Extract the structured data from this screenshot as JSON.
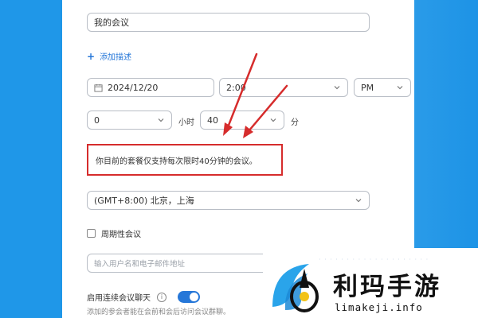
{
  "form": {
    "title_value": "我的会议",
    "add_description": "添加描述",
    "date_value": "2024/12/20",
    "time_value": "2:00",
    "ampm_value": "PM",
    "duration_hours": "0",
    "hours_unit": "小时",
    "duration_minutes": "40",
    "minutes_unit": "分",
    "limit_notice": "你目前的套餐仅支持每次限时40分钟的会议。",
    "timezone_value": "(GMT+8:00) 北京，上海",
    "recurring_label": "周期性会议",
    "invitee_placeholder": "输入用户名和电子邮件地址",
    "continuous_chat_label": "启用连续会议聊天",
    "continuous_chat_enabled": true,
    "continuous_chat_desc": "添加的参会者能在会前和会后访问会议群聊。"
  },
  "watermark": {
    "title": "利玛手游",
    "url": "limakeji.info"
  },
  "colors": {
    "background": "#1f97e8",
    "accent": "#2677d8",
    "annotation": "#d62c2c"
  }
}
